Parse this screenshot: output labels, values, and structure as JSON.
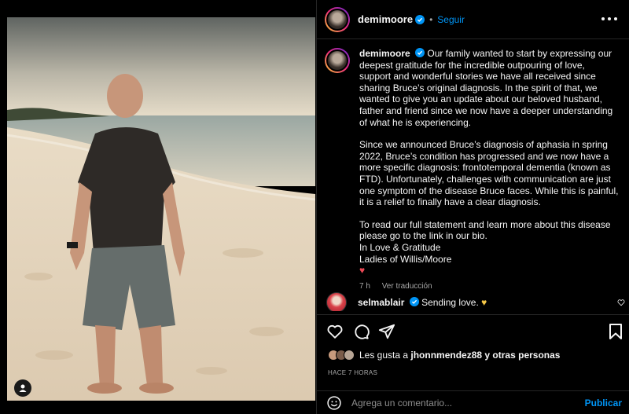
{
  "post": {
    "username": "demimoore",
    "follow_label": "Seguir",
    "dot": "•"
  },
  "caption": {
    "username": "demimoore",
    "p1": "Our family wanted to start by expressing our deepest gratitude for the incredible outpouring of love, support and wonderful stories we have all received since sharing Bruce’s original diagnosis. In the spirit of that, we wanted to give you an update about our beloved husband, father and friend since we now have a deeper understanding of what he is experiencing.",
    "p2": "Since we announced Bruce’s diagnosis of aphasia in spring 2022, Bruce’s condition has progressed and we now have a more specific diagnosis: frontotemporal dementia (known as FTD). Unfortunately, challenges with communication are just one symptom of the disease Bruce faces. While this is painful, it is a relief to finally have a clear diagnosis.",
    "p3": "To read our full statement and learn more about this disease please go to the link in our bio.",
    "sign1": "In Love & Gratitude",
    "sign2": "Ladies of Willis/Moore",
    "heart": "♥",
    "time": "7 h",
    "translate": "Ver traducción"
  },
  "comment": {
    "username": "selmablair",
    "text": "Sending love.",
    "emoji": "♥"
  },
  "likes": {
    "prefix": "Les gusta a",
    "user": "jhonnmendez88",
    "suffix": "y otras personas"
  },
  "timestamp": "HACE 7 HORAS",
  "add_comment": {
    "placeholder": "Agrega un comentario...",
    "publish": "Publicar"
  },
  "colors": {
    "accent": "#0095f6",
    "background": "#000000",
    "like_red": "#ed4956"
  }
}
